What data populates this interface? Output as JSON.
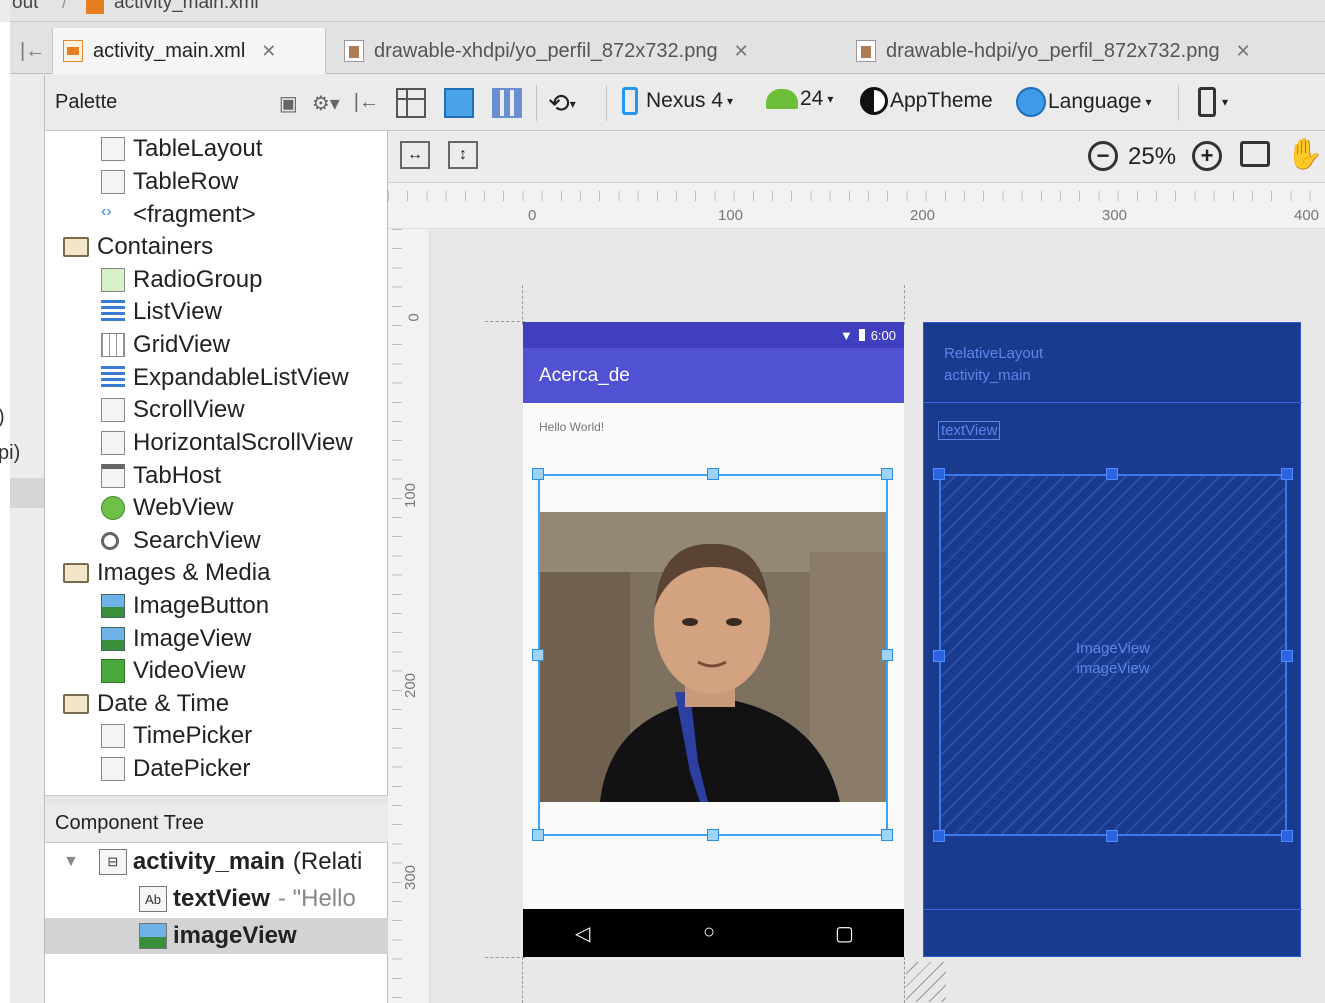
{
  "breadcrumb": {
    "items": [
      "out",
      "activity_main.xml"
    ]
  },
  "tabs": [
    {
      "label": "activity_main.xml",
      "active": true
    },
    {
      "label": "drawable-xhdpi/yo_perfil_872x732.png",
      "active": false
    },
    {
      "label": "drawable-hdpi/yo_perfil_872x732.png",
      "active": false
    }
  ],
  "sidebar": {
    "fragments": [
      ")",
      "pi)"
    ]
  },
  "palette": {
    "title": "Palette",
    "items": [
      {
        "label": "TableLayout",
        "kind": "widget"
      },
      {
        "label": "TableRow",
        "kind": "widget"
      },
      {
        "label": "<fragment>",
        "kind": "widget"
      },
      {
        "label": "Containers",
        "kind": "folder"
      },
      {
        "label": "RadioGroup",
        "kind": "widget"
      },
      {
        "label": "ListView",
        "kind": "widget"
      },
      {
        "label": "GridView",
        "kind": "widget"
      },
      {
        "label": "ExpandableListView",
        "kind": "widget"
      },
      {
        "label": "ScrollView",
        "kind": "widget"
      },
      {
        "label": "HorizontalScrollView",
        "kind": "widget"
      },
      {
        "label": "TabHost",
        "kind": "widget"
      },
      {
        "label": "WebView",
        "kind": "widget"
      },
      {
        "label": "SearchView",
        "kind": "widget"
      },
      {
        "label": "Images & Media",
        "kind": "folder"
      },
      {
        "label": "ImageButton",
        "kind": "widget"
      },
      {
        "label": "ImageView",
        "kind": "widget"
      },
      {
        "label": "VideoView",
        "kind": "widget"
      },
      {
        "label": "Date & Time",
        "kind": "folder"
      },
      {
        "label": "TimePicker",
        "kind": "widget"
      },
      {
        "label": "DatePicker",
        "kind": "widget"
      }
    ]
  },
  "component_tree": {
    "title": "Component Tree",
    "root": {
      "name": "activity_main",
      "suffix": "(Relati"
    },
    "children": [
      {
        "name": "textView",
        "suffix": "- \"Hello"
      },
      {
        "name": "imageView",
        "suffix": ""
      }
    ]
  },
  "toolbar": {
    "device": "Nexus 4",
    "api": "24",
    "theme": "AppTheme",
    "language": "Language",
    "zoom": "25%"
  },
  "rulers": {
    "horizontal": [
      "0",
      "100",
      "200",
      "300",
      "400"
    ],
    "vertical": [
      "0",
      "100",
      "200",
      "300"
    ]
  },
  "design": {
    "status_time": "6:00",
    "app_title": "Acerca_de",
    "hello_text": "Hello World!"
  },
  "blueprint": {
    "layout_type": "RelativeLayout",
    "layout_id": "activity_main",
    "textview_id": "textView",
    "image_type": "ImageView",
    "image_id": "imageView"
  },
  "colors": {
    "app_bar": "#5151d3",
    "status_bar": "#3f3fbf",
    "blueprint_bg": "#1a3a8e",
    "selection": "#3ea3f0"
  }
}
